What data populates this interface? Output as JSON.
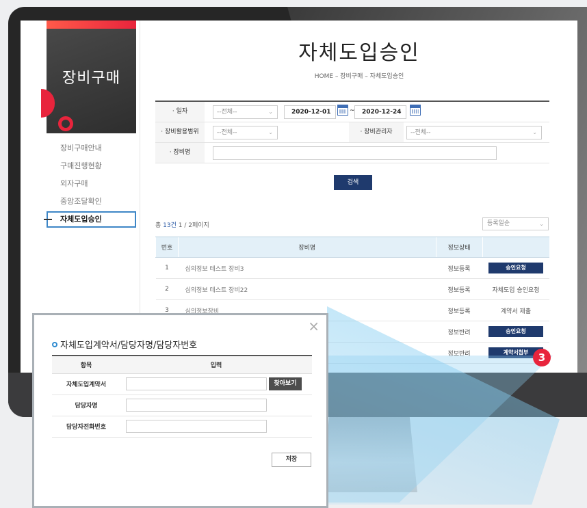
{
  "sidebar": {
    "title": "장비구매",
    "items": [
      {
        "label": "장비구매안내"
      },
      {
        "label": "구매진행현황"
      },
      {
        "label": "외자구매"
      },
      {
        "label": "중앙조달확인"
      }
    ],
    "active_item": "자체도입승인"
  },
  "page": {
    "title": "자체도입승인",
    "breadcrumb": "HOME  –  장비구매  –  자체도입승인"
  },
  "search": {
    "date_label": "· 일자",
    "date_select": "--전체--",
    "date_from": "2020-12-01",
    "date_sep": "~",
    "date_to": "2020-12-24",
    "scope_label": "· 장비활용범위",
    "scope_select": "--전체--",
    "manager_label": "· 장비관리자",
    "manager_select": "--전체--",
    "name_label": "· 장비명",
    "name_value": "",
    "search_button": "검색"
  },
  "list": {
    "total_prefix": "총 ",
    "total_count": "13건",
    "page_info": " 1 / 2페이지",
    "sort_label": "등록일순",
    "columns": [
      "번호",
      "장비명",
      "정보상태",
      ""
    ],
    "rows": [
      {
        "no": "1",
        "name": "심의정보 테스트 장비3",
        "status": "정보등록",
        "action": "승인요청",
        "action_type": "button",
        "status_color": "normal"
      },
      {
        "no": "2",
        "name": "심의정보 테스트 장비22",
        "status": "정보등록",
        "action": "자체도입 승인요청",
        "action_type": "text",
        "status_color": "normal"
      },
      {
        "no": "3",
        "name": "심의정보장비",
        "status": "정보등록",
        "action": "계약서 제출",
        "action_type": "text",
        "status_color": "normal"
      },
      {
        "no": "",
        "name": "",
        "status": "정보반려",
        "action": "승인요청",
        "action_type": "button",
        "status_color": "red"
      },
      {
        "no": "",
        "name": "",
        "status": "정보반려",
        "action": "계약서첨부",
        "action_type": "button",
        "status_color": "red"
      }
    ]
  },
  "step_badge": "3",
  "popup": {
    "title": "자체도입계약서/담당자명/담당자번호",
    "col_item": "항목",
    "col_input": "입력",
    "fields": [
      {
        "label": "자체도입계약서",
        "value": ""
      },
      {
        "label": "담당자명",
        "value": ""
      },
      {
        "label": "담당자전화번호",
        "value": ""
      }
    ],
    "browse_button": "찾아보기",
    "save_button": "저장",
    "close_icon": "×"
  },
  "colors": {
    "brand_red": "#e8243c",
    "navy_button": "#1f3a6d",
    "table_header": "#e3f0f8",
    "active_border": "#3d86c6"
  }
}
